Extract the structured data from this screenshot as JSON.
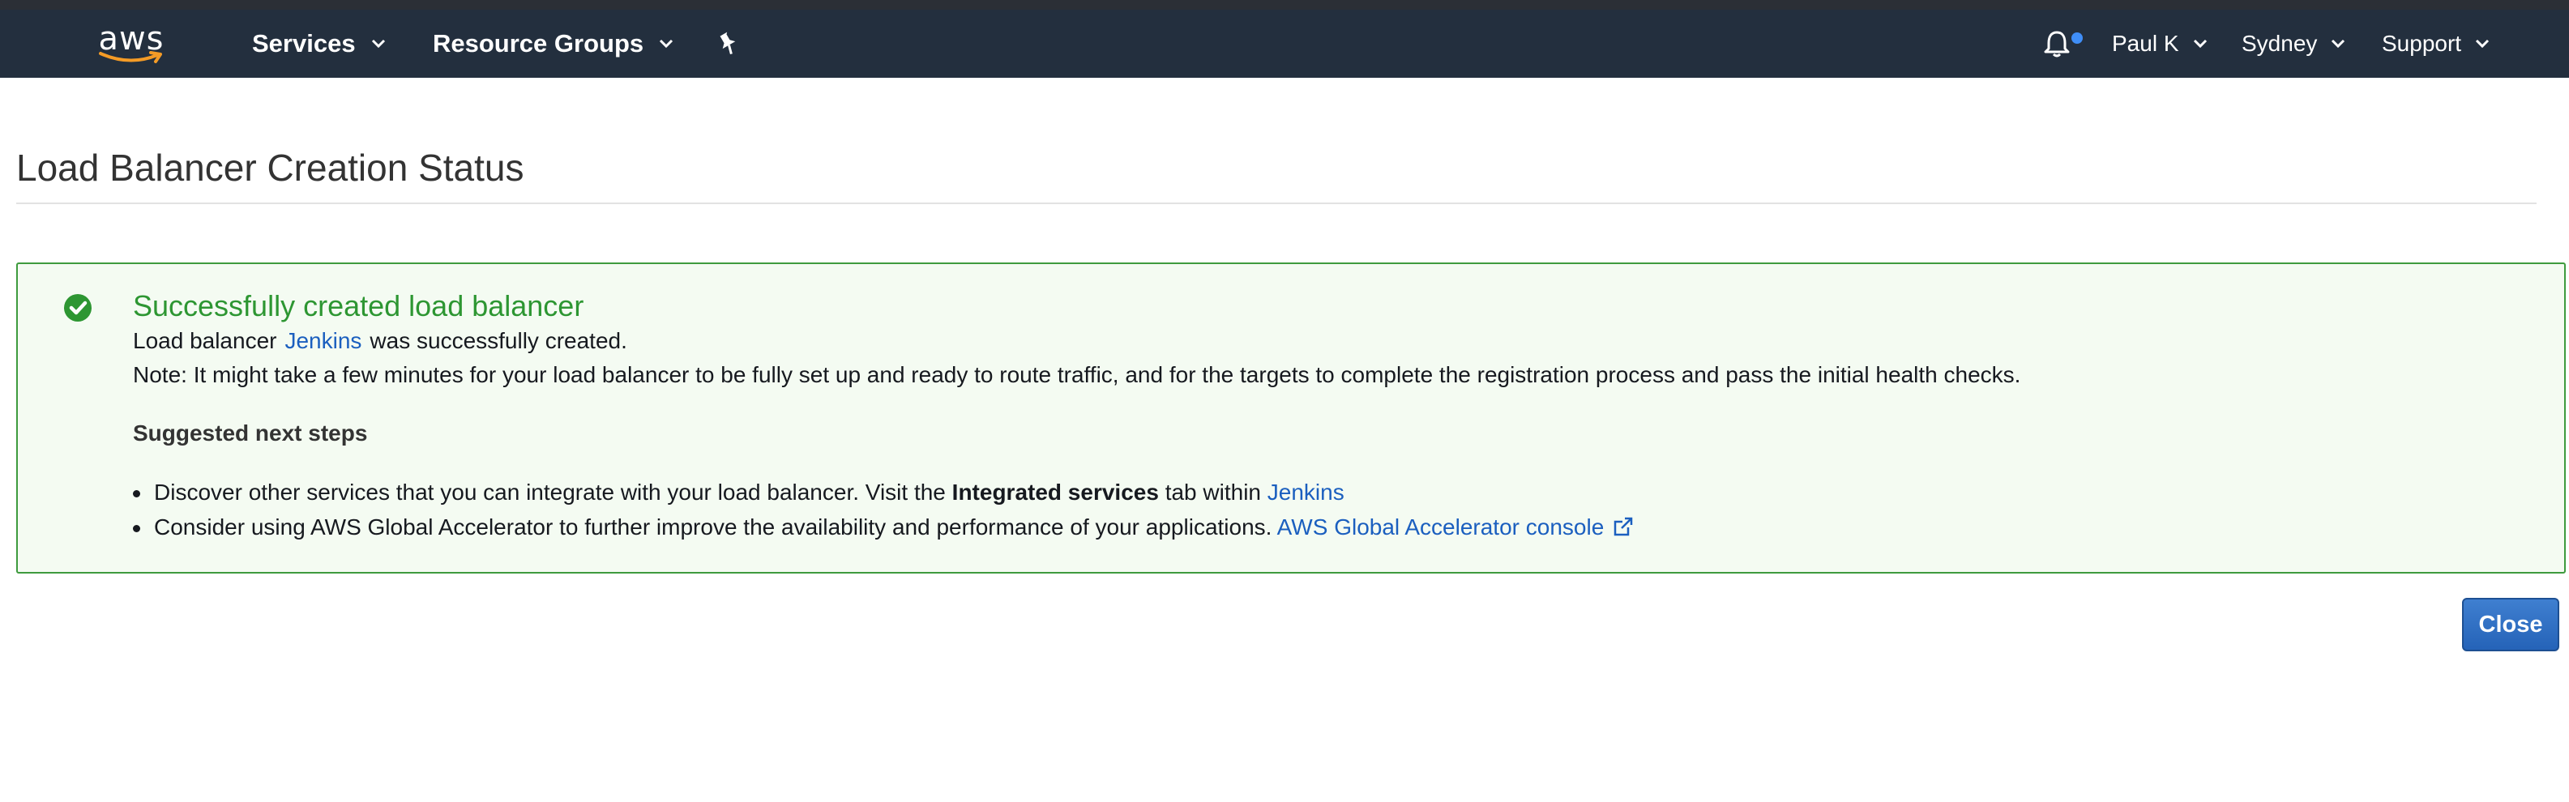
{
  "nav": {
    "logo_text": "aws",
    "services_label": "Services",
    "resource_groups_label": "Resource Groups",
    "user_label": "Paul K",
    "region_label": "Sydney",
    "support_label": "Support",
    "colors": {
      "bar": "#232f3e",
      "notification_dot": "#3f8ef7"
    }
  },
  "page": {
    "title": "Load Balancer Creation Status"
  },
  "alert": {
    "title": "Successfully created load balancer",
    "created_prefix": "Load balancer",
    "lb_name": "Jenkins",
    "created_suffix": "was successfully created.",
    "note": "Note: It might take a few minutes for your load balancer to be fully set up and ready to route traffic, and for the targets to complete the registration process and pass the initial health checks.",
    "next_steps_heading": "Suggested next steps",
    "step1_prefix": "Discover other services that you can integrate with your load balancer. Visit the",
    "step1_bold": "Integrated services",
    "step1_middle": "tab within",
    "step1_link": "Jenkins",
    "step2_text": "Consider using AWS Global Accelerator to further improve the availability and performance of your applications.",
    "step2_link": "AWS Global Accelerator console",
    "colors": {
      "border": "#3e9b3e",
      "background": "#f4fbf2",
      "title": "#2d9632",
      "link": "#1b5fbf"
    }
  },
  "actions": {
    "close_label": "Close"
  }
}
